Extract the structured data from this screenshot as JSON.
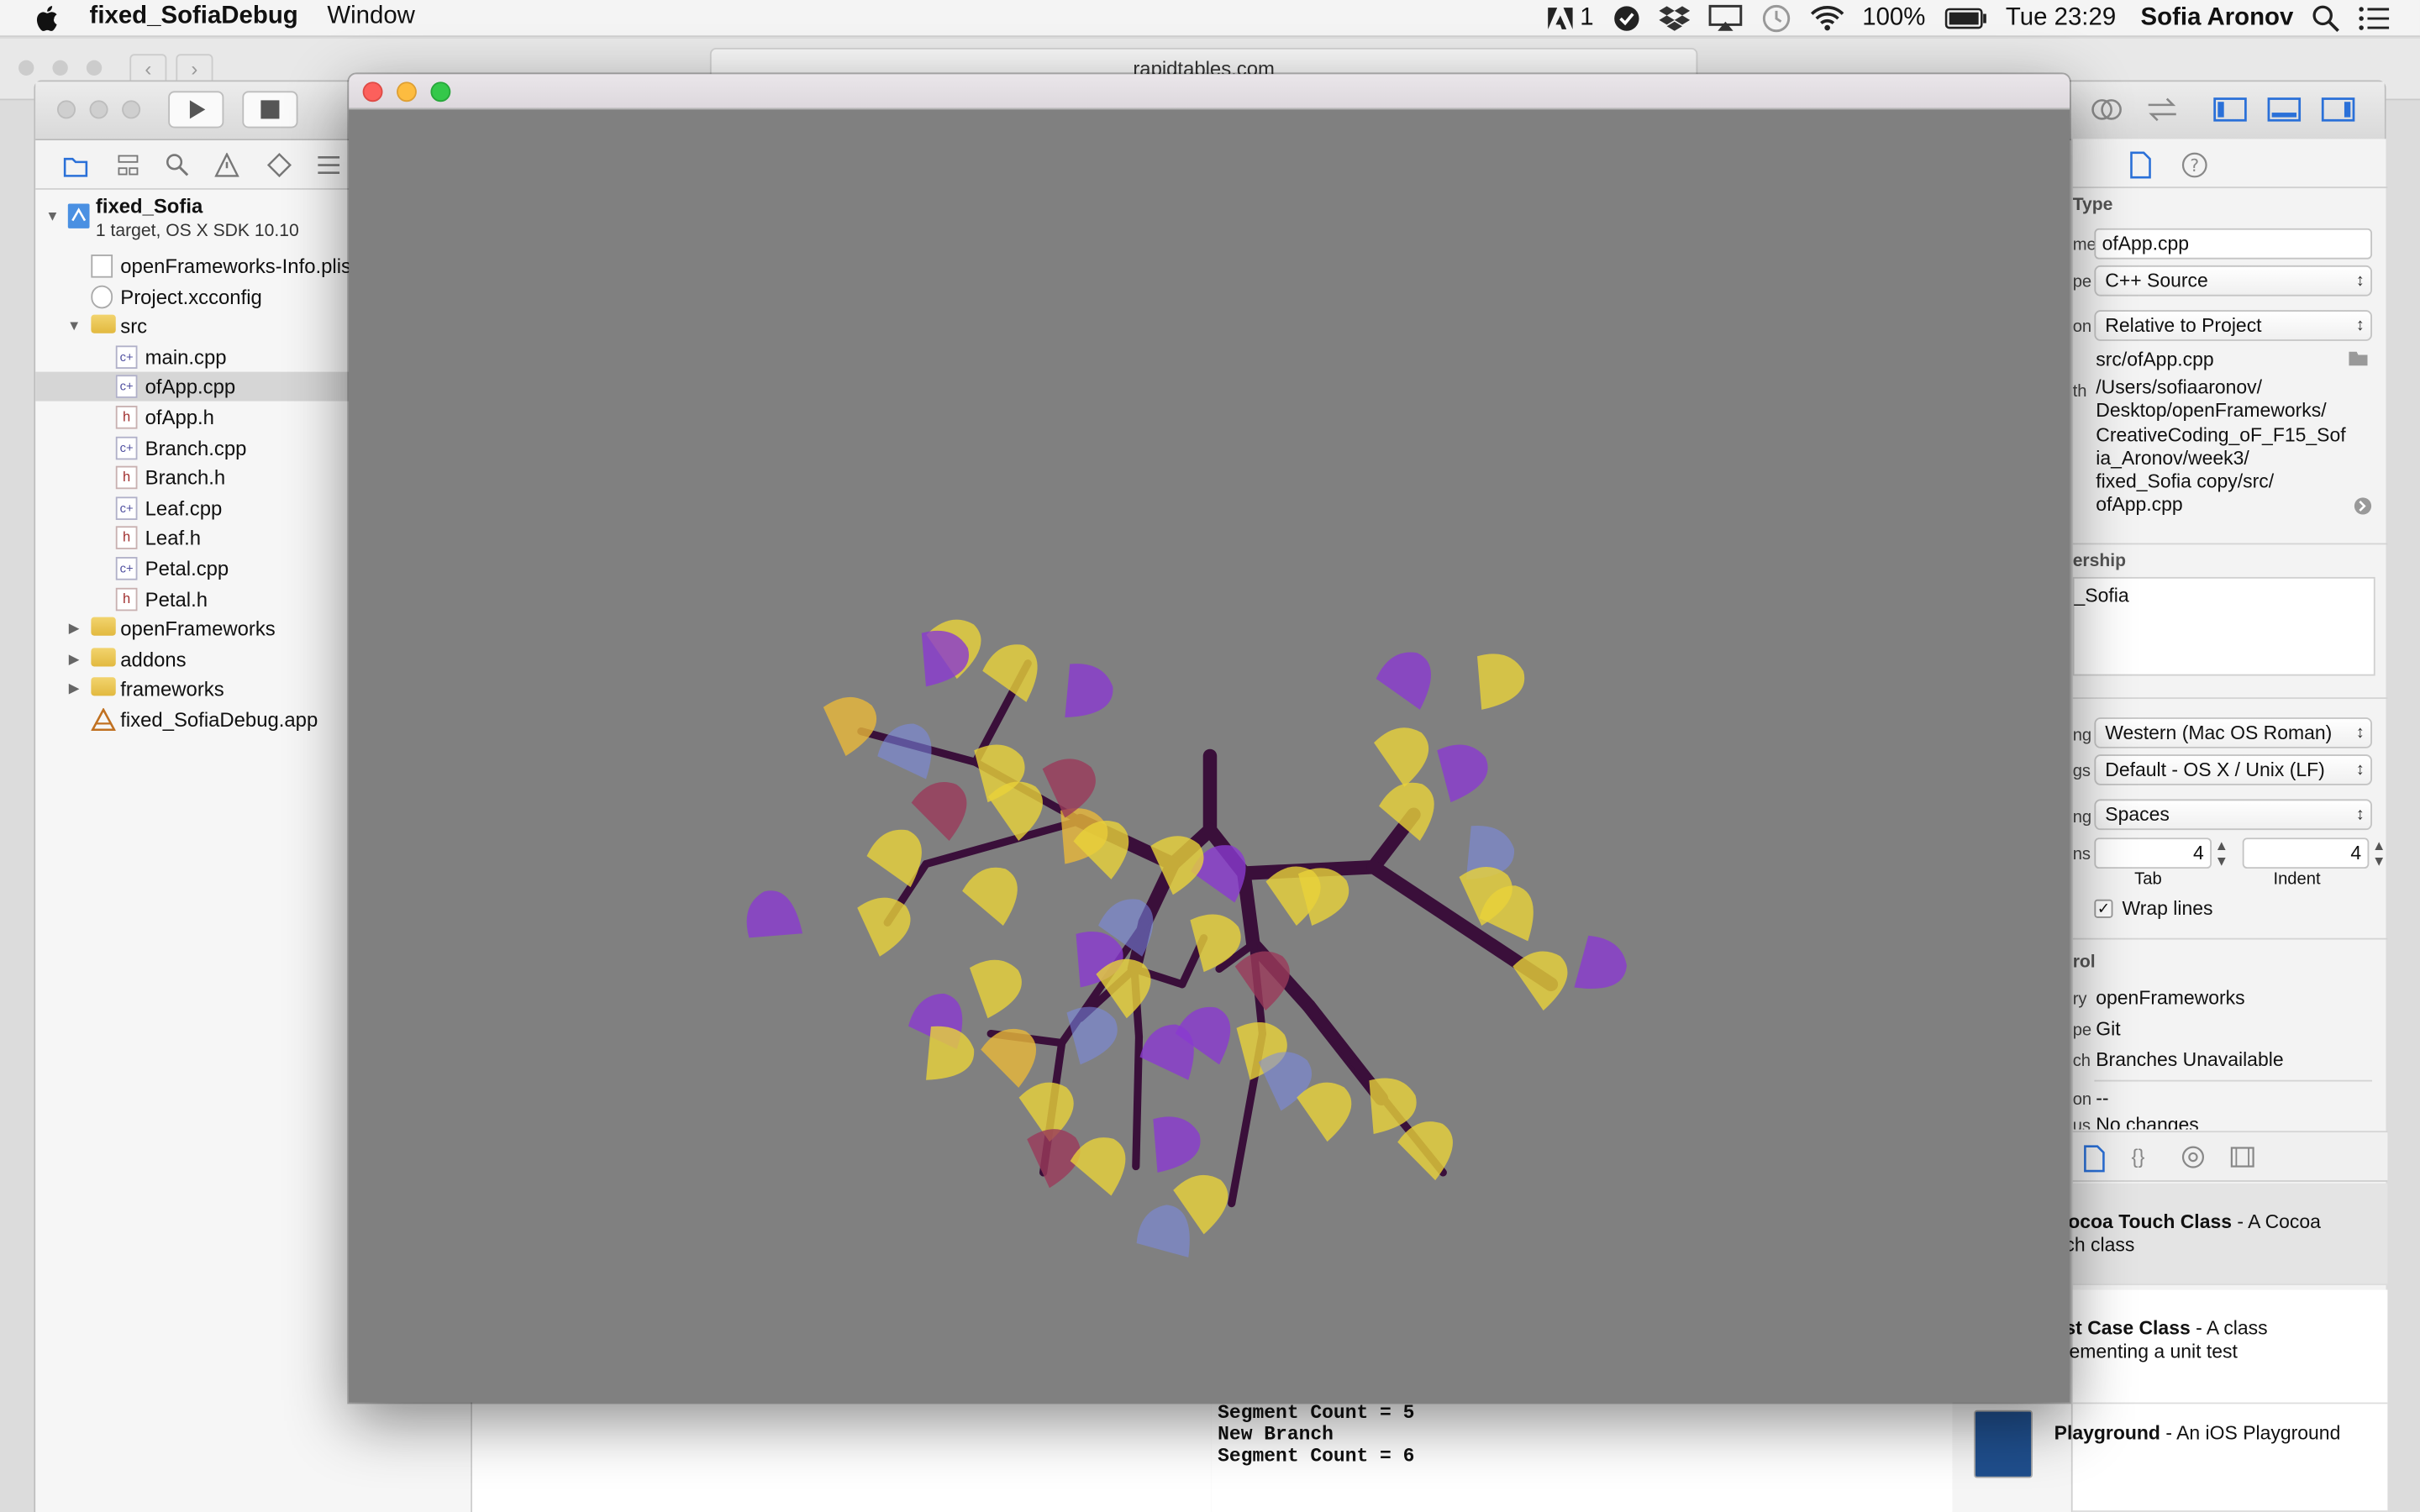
{
  "menubar": {
    "app_name": "fixed_SofiaDebug",
    "menus": [
      "Window"
    ],
    "status": {
      "badge": "1",
      "battery": "100%",
      "clock": "Tue 23:29",
      "user": "Sofia Aronov"
    }
  },
  "browser": {
    "url": "rapidtables.com"
  },
  "navigator": {
    "project_name": "fixed_Sofia",
    "project_sub": "1 target, OS X SDK 10.10",
    "items": [
      {
        "label": "openFrameworks-Info.plist",
        "kind": "plist",
        "level": 1
      },
      {
        "label": "Project.xcconfig",
        "kind": "config",
        "level": 1
      },
      {
        "label": "src",
        "kind": "folder",
        "level": 1,
        "open": true
      },
      {
        "label": "main.cpp",
        "kind": "cpp",
        "level": 2
      },
      {
        "label": "ofApp.cpp",
        "kind": "cpp",
        "level": 2,
        "selected": true
      },
      {
        "label": "ofApp.h",
        "kind": "h",
        "level": 2
      },
      {
        "label": "Branch.cpp",
        "kind": "cpp",
        "level": 2
      },
      {
        "label": "Branch.h",
        "kind": "h",
        "level": 2
      },
      {
        "label": "Leaf.cpp",
        "kind": "cpp",
        "level": 2
      },
      {
        "label": "Leaf.h",
        "kind": "h",
        "level": 2
      },
      {
        "label": "Petal.cpp",
        "kind": "cpp",
        "level": 2
      },
      {
        "label": "Petal.h",
        "kind": "h",
        "level": 2
      },
      {
        "label": "openFrameworks",
        "kind": "folder",
        "level": 1,
        "open": false
      },
      {
        "label": "addons",
        "kind": "folder",
        "level": 1,
        "open": false
      },
      {
        "label": "frameworks",
        "kind": "folder",
        "level": 1,
        "open": false
      },
      {
        "label": "fixed_SofiaDebug.app",
        "kind": "app",
        "level": 1
      }
    ]
  },
  "inspector": {
    "section_identity": "Type",
    "name_label": "me",
    "name_value": "ofApp.cpp",
    "type_label": "pe",
    "type_value": "C++ Source",
    "location_label": "on",
    "location_value": "Relative to Project",
    "relpath": "src/ofApp.cpp",
    "fullpath_label": "th",
    "fullpath_lines": [
      "/Users/sofiaaronov/",
      "Desktop/openFrameworks/",
      "CreativeCoding_oF_F15_Sof",
      "ia_Aronov/week3/",
      "fixed_Sofia copy/src/",
      "ofApp.cpp"
    ],
    "section_membership": "ership",
    "membership_target": "_Sofia",
    "encoding_label": "ng",
    "encoding_value": "Western (Mac OS Roman)",
    "endings_label": "gs",
    "endings_value": "Default - OS X / Unix (LF)",
    "indent_label": "ng",
    "indent_value": "Spaces",
    "widths_label": "ns",
    "tab_value": "4",
    "indent_width_value": "4",
    "tab_caption": "Tab",
    "indent_caption": "Indent",
    "wrap_label": "Wrap lines",
    "wrap_checked": "✓",
    "section_source": "rol",
    "repo_label": "ry",
    "repo_value": "openFrameworks",
    "scm_label": "pe",
    "scm_value": "Git",
    "branch_label": "ch",
    "branch_value": "Branches Unavailable",
    "version_label": "on",
    "version_value": "--",
    "status_label": "us",
    "status_value": "No changes",
    "library": [
      {
        "title": "Cocoa Touch Class",
        "desc": " - A Cocoa",
        "desc2": "uch class",
        "highlight": true
      },
      {
        "title": "est Case Class",
        "desc": " - A class",
        "desc2": "plementing a unit test",
        "highlight": false
      },
      {
        "title": "Playground",
        "desc": " - An iOS Playground",
        "desc2": "",
        "highlight": false
      }
    ]
  },
  "console": {
    "lines": [
      "Segment Count = 5",
      "New Branch",
      "Segment Count = 6"
    ]
  },
  "colors": {
    "canvas_bg": "#808080",
    "branch": "#3a0f3a",
    "leaf_yellow": "#e8d23a",
    "leaf_gold": "#e8b83a",
    "leaf_purple": "#8a3ad0",
    "leaf_blue": "#7a8ae8",
    "leaf_maroon": "#9a3a5a"
  }
}
